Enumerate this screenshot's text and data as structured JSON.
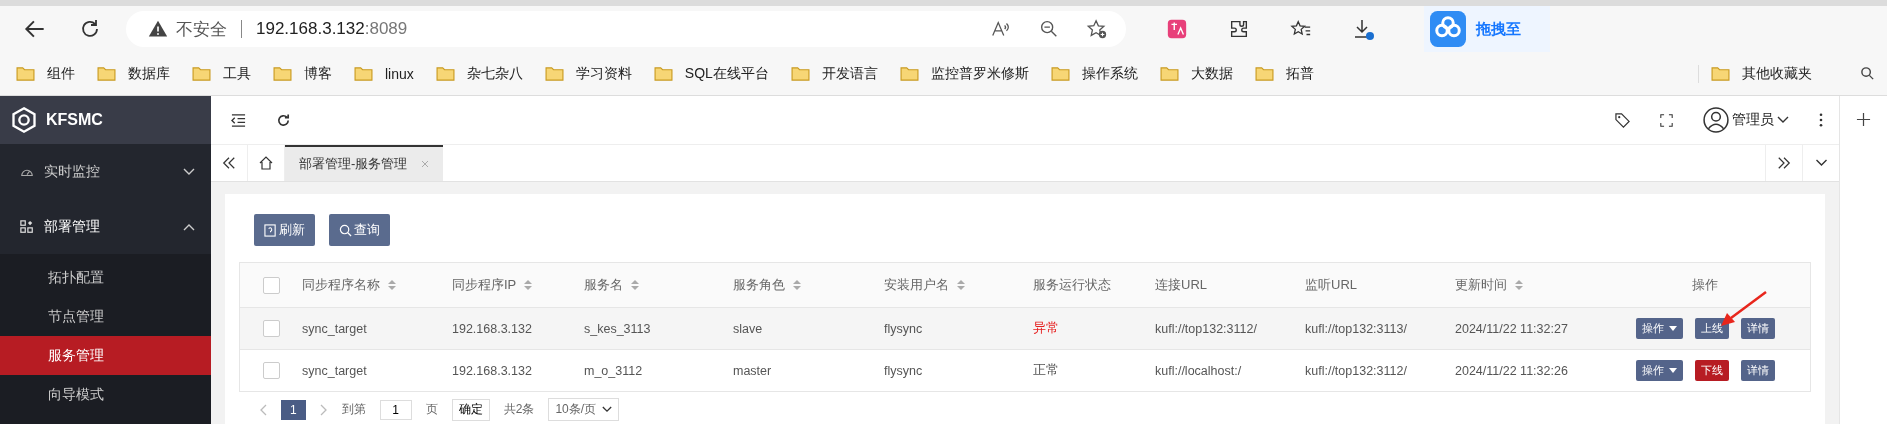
{
  "browser": {
    "address": {
      "warning": "不安全",
      "host": "192.168.3.132",
      "port": ":8089"
    },
    "bookmarks": [
      "组件",
      "数据库",
      "工具",
      "博客",
      "linux",
      "杂七杂八",
      "学习资料",
      "SQL在线平台",
      "开发语言",
      "监控普罗米修斯",
      "操作系统",
      "大数据",
      "拓普"
    ],
    "other_bookmarks": "其他收藏夹",
    "netdisk_popup": "拖拽至"
  },
  "app": {
    "logo": "KFSMC",
    "sidebar": [
      {
        "label": "实时监控",
        "expanded": false
      },
      {
        "label": "部署管理",
        "expanded": true,
        "children": [
          {
            "label": "拓扑配置",
            "selected": false
          },
          {
            "label": "节点管理",
            "selected": false
          },
          {
            "label": "服务管理",
            "selected": true
          },
          {
            "label": "向导模式",
            "selected": false
          }
        ]
      }
    ],
    "user": "管理员",
    "tabs": [
      {
        "label": "部署管理-服务管理",
        "selected": true
      }
    ],
    "buttons": [
      "刷新",
      "查询"
    ],
    "table": {
      "select_all_checked": false,
      "columns": [
        {
          "label": "同步程序名称",
          "sortable": true
        },
        {
          "label": "同步程序IP",
          "sortable": true
        },
        {
          "label": "服务名",
          "sortable": true
        },
        {
          "label": "服务角色",
          "sortable": true
        },
        {
          "label": "安装用户名",
          "sortable": true
        },
        {
          "label": "服务运行状态",
          "sortable": false
        },
        {
          "label": "连接URL",
          "sortable": false
        },
        {
          "label": "监听URL",
          "sortable": false
        },
        {
          "label": "更新时间",
          "sortable": true
        },
        {
          "label": "操作",
          "sortable": false
        }
      ],
      "rows": [
        {
          "checked": false,
          "cells": [
            "sync_target",
            "192.168.3.132",
            "s_kes_3113",
            "slave",
            "flysync"
          ],
          "status": {
            "text": "异常",
            "kind": "error"
          },
          "urls": [
            "kufl://top132:3112/",
            "kufl://top132:3113/"
          ],
          "time": "2024/11/22 11:32:27",
          "actions": {
            "menu": "操作",
            "toggle": {
              "label": "上线",
              "kind": "online"
            },
            "details": "详情"
          }
        },
        {
          "checked": false,
          "cells": [
            "sync_target",
            "192.168.3.132",
            "m_o_3112",
            "master",
            "flysync"
          ],
          "status": {
            "text": "正常",
            "kind": "ok"
          },
          "urls": [
            "kufl://localhost:/",
            "kufl://top132:3112/"
          ],
          "time": "2024/11/22 11:32:26",
          "actions": {
            "menu": "操作",
            "toggle": {
              "label": "下线",
              "kind": "offline"
            },
            "details": "详情"
          }
        }
      ]
    },
    "pagination": {
      "pages": [
        {
          "label": "1",
          "selected": true
        }
      ],
      "goto": "到第",
      "page_value": "1",
      "page_unit": "页",
      "confirm": "确定",
      "total": "共2条",
      "page_size": "10条/页"
    }
  }
}
